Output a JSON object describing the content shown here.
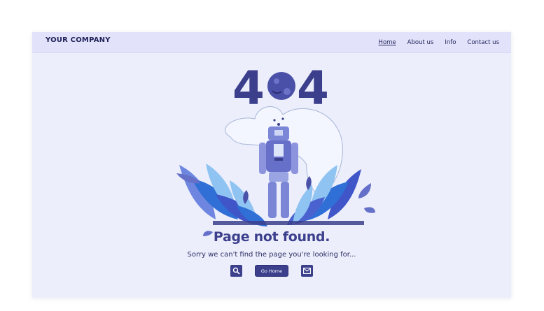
{
  "header": {
    "company": "YOUR COMPANY",
    "nav": [
      {
        "label": "Home"
      },
      {
        "label": "About us"
      },
      {
        "label": "Info"
      },
      {
        "label": "Contact us"
      }
    ]
  },
  "error": {
    "code_left": "4",
    "code_right": "4",
    "title": "Page not found.",
    "subtitle": "Sorry we can't find the page you're looking for..."
  },
  "actions": {
    "search_icon": "search-icon",
    "home_label": "Go Home",
    "mail_icon": "mail-icon"
  },
  "colors": {
    "accent": "#3b3f8c",
    "background": "#eceefc",
    "header": "#e2e3fa"
  }
}
